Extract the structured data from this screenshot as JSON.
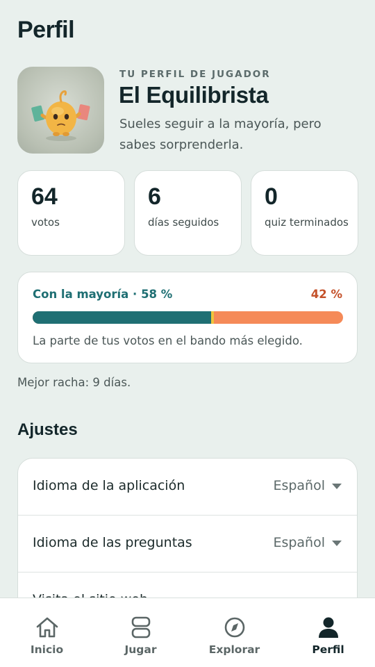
{
  "header": {
    "title": "Perfil"
  },
  "profile": {
    "kicker": "TU PERFIL DE JUGADOR",
    "name": "El Equilibrista",
    "description": "Sueles seguir a la mayoría, pero sabes sorprenderla.",
    "avatar_icon": "balancing-character-illustration"
  },
  "stats": [
    {
      "value": "64",
      "label": "votos"
    },
    {
      "value": "6",
      "label": "días seguidos"
    },
    {
      "value": "0",
      "label": "quiz terminados"
    }
  ],
  "majority": {
    "left_text": "Con la mayoría · 58 %",
    "right_text": "42 %",
    "majority_percent": 58,
    "caption": "La parte de tus votos en el bando más elegido.",
    "colors": {
      "majority": "#1f6f73",
      "minority": "#f58a58",
      "divider": "#f0c33c"
    }
  },
  "best_streak": "Mejor racha: 9 días.",
  "settings": {
    "title": "Ajustes",
    "rows": [
      {
        "label": "Idioma de la aplicación",
        "value": "Español",
        "icon": "caret-down-icon"
      },
      {
        "label": "Idioma de las preguntas",
        "value": "Español",
        "icon": "caret-down-icon"
      },
      {
        "label": "Visita el sitio web",
        "icon": "chevron-right-icon"
      }
    ]
  },
  "bottom_nav": {
    "items": [
      {
        "label": "Inicio",
        "icon": "home-icon"
      },
      {
        "label": "Jugar",
        "icon": "cards-icon"
      },
      {
        "label": "Explorar",
        "icon": "compass-icon"
      },
      {
        "label": "Perfil",
        "icon": "person-icon",
        "active": true
      }
    ]
  }
}
